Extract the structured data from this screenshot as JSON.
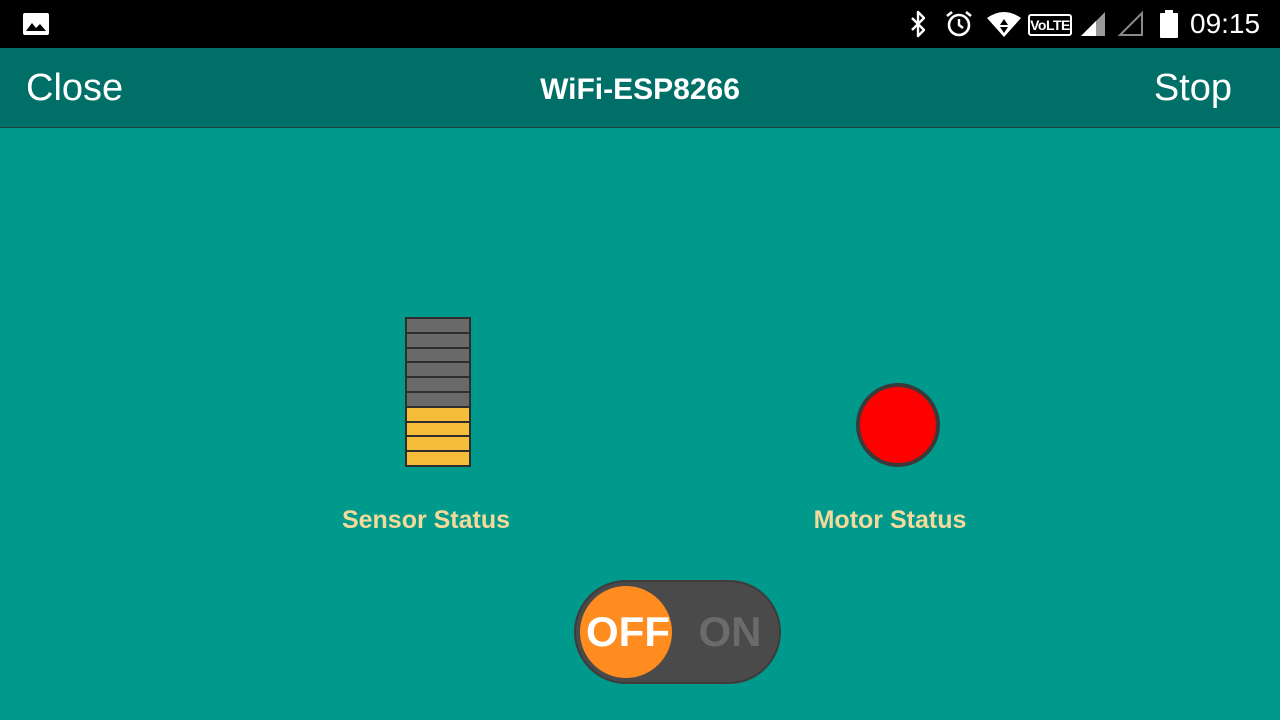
{
  "status_bar": {
    "time": "09:15",
    "volte_label": "VoLTE",
    "icons": [
      "gallery-icon",
      "bluetooth-icon",
      "alarm-icon",
      "wifi-icon",
      "volte-icon",
      "signal-icon",
      "signal-empty-icon",
      "battery-icon"
    ]
  },
  "app_bar": {
    "close_label": "Close",
    "title": "WiFi-ESP8266",
    "stop_label": "Stop"
  },
  "sensor": {
    "label": "Sensor Status",
    "level_segments_total": 10,
    "level_segments_on": 4,
    "on_color": "#f5bd3a",
    "off_color": "#6a6a6a"
  },
  "motor": {
    "label": "Motor Status",
    "led_color": "#ff0000"
  },
  "toggle": {
    "off_label": "OFF",
    "on_label": "ON",
    "state": "OFF",
    "knob_color": "#ff8c1f"
  },
  "colors": {
    "background": "#009a8d",
    "app_bar": "#006f67",
    "label_text": "#f4d99a"
  }
}
